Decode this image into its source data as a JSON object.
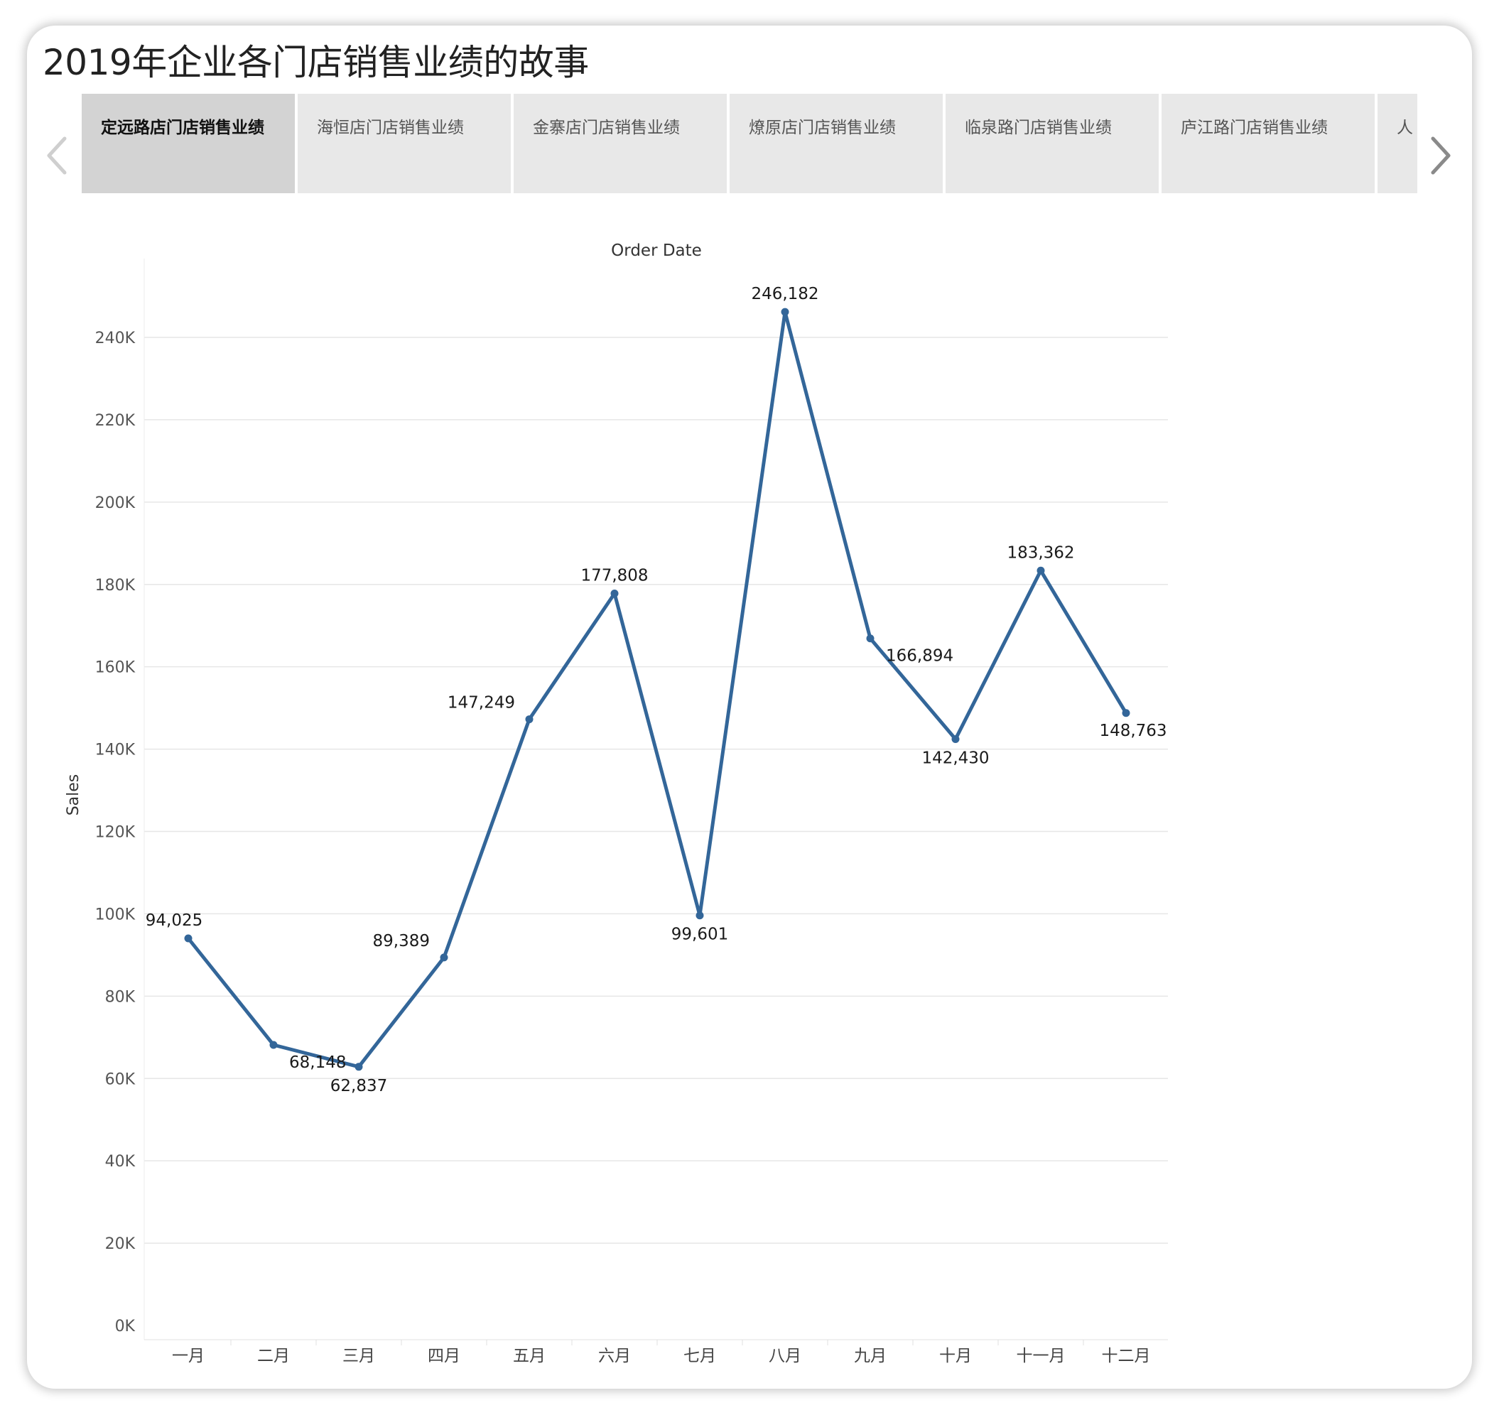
{
  "story": {
    "title": "2019年企业各门店销售业绩的故事"
  },
  "tabs": [
    {
      "label": "定远路店门店销售业绩",
      "active": true
    },
    {
      "label": "海恒店门店销售业绩",
      "active": false
    },
    {
      "label": "金寨店门店销售业绩",
      "active": false
    },
    {
      "label": "燎原店门店销售业绩",
      "active": false
    },
    {
      "label": "临泉路门店销售业绩",
      "active": false
    },
    {
      "label": "庐江路门店销售业绩",
      "active": false
    },
    {
      "label": "人",
      "active": false
    }
  ],
  "icons": {
    "prev": "chevron-left-icon",
    "next": "chevron-right-icon"
  },
  "colors": {
    "line": "#336699",
    "gridline": "#e6e6e6",
    "active_tab": "#d3d3d3",
    "tab": "#e8e8e8"
  },
  "chart_data": {
    "type": "line",
    "title": "Order Date",
    "xlabel": "Order Date",
    "ylabel": "Sales",
    "categories": [
      "一月",
      "二月",
      "三月",
      "四月",
      "五月",
      "六月",
      "七月",
      "八月",
      "九月",
      "十月",
      "十一月",
      "十二月"
    ],
    "series": [
      {
        "values": [
          94025,
          68148,
          62837,
          89389,
          147249,
          177808,
          99601,
          246182,
          166894,
          142430,
          183362,
          148763
        ],
        "labels": [
          "94,025",
          "68,148",
          "62,837",
          "89,389",
          "147,249",
          "177,808",
          "99,601",
          "246,182",
          "166,894",
          "142,430",
          "183,362",
          "148,763"
        ]
      }
    ],
    "y_ticks": [
      0,
      20000,
      40000,
      60000,
      80000,
      100000,
      120000,
      140000,
      160000,
      180000,
      200000,
      220000,
      240000
    ],
    "y_tick_labels": [
      "0K",
      "20K",
      "40K",
      "60K",
      "80K",
      "100K",
      "120K",
      "140K",
      "160K",
      "180K",
      "200K",
      "220K",
      "240K"
    ],
    "ylim": [
      0,
      240000
    ],
    "grid": true,
    "legend": "none"
  }
}
